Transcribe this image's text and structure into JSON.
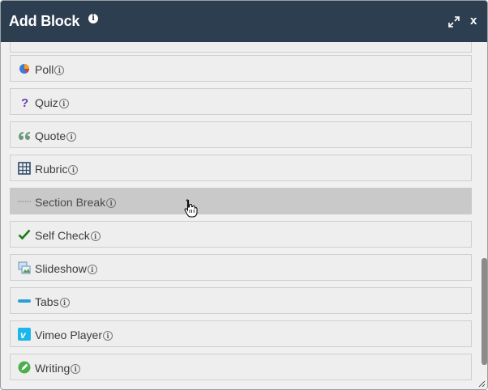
{
  "dialog": {
    "title": "Add Block",
    "info_glyph": "i",
    "close_label": "x",
    "expand_icon": "expand-arrows-icon",
    "resize_icon": "resize-grip-icon"
  },
  "blocks": [
    {
      "label": "Poll",
      "icon": "pie-chart-icon"
    },
    {
      "label": "Quiz",
      "icon": "question-mark-icon"
    },
    {
      "label": "Quote",
      "icon": "quote-icon"
    },
    {
      "label": "Rubric",
      "icon": "grid-table-icon"
    },
    {
      "label": "Section Break",
      "icon": "dotted-line-icon",
      "hovered": true
    },
    {
      "label": "Self Check",
      "icon": "checkmark-icon"
    },
    {
      "label": "Slideshow",
      "icon": "slideshow-images-icon"
    },
    {
      "label": "Tabs",
      "icon": "tabs-bar-icon"
    },
    {
      "label": "Vimeo Player",
      "icon": "vimeo-icon"
    },
    {
      "label": "Writing",
      "icon": "pencil-circle-icon"
    }
  ],
  "colors": {
    "titlebar": "#2d3e50",
    "hover_row": "#c9c9c9",
    "checkmark": "#1a7a1a",
    "tabs": "#2aa0d8",
    "vimeo": "#1ab7ea",
    "writing": "#4cae4c",
    "quiz": "#6a3fb5"
  }
}
